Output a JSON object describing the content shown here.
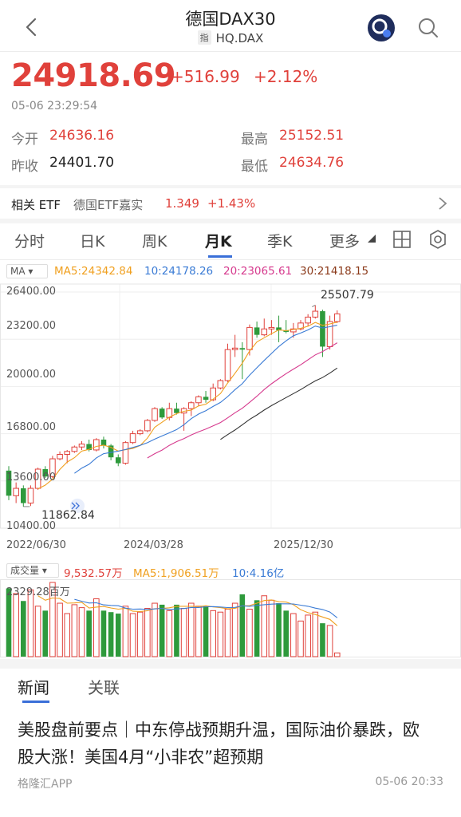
{
  "header": {
    "title": "德国DAX30",
    "tag": "指",
    "code": "HQ.DAX"
  },
  "quote": {
    "price": "24918.69",
    "change": "+516.99",
    "change_pct": "+2.12%",
    "timestamp": "05-06 23:29:54",
    "open_label": "今开",
    "open": "24636.16",
    "high_label": "最高",
    "high": "25152.51",
    "prev_close_label": "昨收",
    "prev_close": "24401.70",
    "low_label": "最低",
    "low": "24634.76"
  },
  "etf": {
    "label": "相关 ETF",
    "name": "德国ETF嘉实",
    "price": "1.349",
    "change_pct": "+1.43%"
  },
  "tabs": [
    "分时",
    "日K",
    "周K",
    "月K",
    "季K",
    "更多"
  ],
  "active_tab": "月K",
  "ma": {
    "selector": "MA",
    "ma5": "MA5:24342.84",
    "ma10": "10:24178.26",
    "ma20": "20:23065.61",
    "ma30": "30:21418.15"
  },
  "price_axis": {
    "labels": [
      "26400.00",
      "23200.00",
      "20000.00",
      "16800.00",
      "13600.00",
      "10400.00"
    ],
    "max_marker": "25507.79",
    "min_marker": "11862.84"
  },
  "date_axis": [
    "2022/06/30",
    "2024/03/28",
    "2025/12/30"
  ],
  "volume": {
    "selector": "成交量",
    "vol": "9,532.57万",
    "ma5": "MA5:1,906.51万",
    "ma10": "10:4.16亿",
    "max_label": "2329.28百万"
  },
  "colors": {
    "up": "#e0413b",
    "down": "#2e9a3c",
    "ma5": "#f0a020",
    "ma10": "#3a7bd5",
    "ma20": "#d63a8e",
    "ma30": "#333333"
  },
  "chart_data": {
    "type": "candlestick",
    "interval": "monthly",
    "ylim": [
      10400,
      26400
    ],
    "candles": [
      [
        14300,
        12600,
        14600,
        12300
      ],
      [
        12600,
        13100,
        13500,
        12100
      ],
      [
        13100,
        12100,
        13300,
        11862.84
      ],
      [
        12100,
        13100,
        13300,
        11900
      ],
      [
        13100,
        14400,
        14500,
        13000
      ],
      [
        14400,
        13900,
        14600,
        13800
      ],
      [
        13900,
        15100,
        15300,
        13800
      ],
      [
        15100,
        15400,
        15600,
        15000
      ],
      [
        15400,
        15600,
        15700,
        14800
      ],
      [
        15600,
        15900,
        16000,
        15500
      ],
      [
        15900,
        16100,
        16300,
        15700
      ],
      [
        16100,
        15700,
        16400,
        15600
      ],
      [
        15700,
        16400,
        16500,
        15600
      ],
      [
        16400,
        16000,
        16600,
        15800
      ],
      [
        16000,
        15200,
        16100,
        15000
      ],
      [
        15200,
        14800,
        15400,
        14600
      ],
      [
        14800,
        16200,
        16300,
        14700
      ],
      [
        16200,
        16800,
        17000,
        16100
      ],
      [
        16800,
        17000,
        17100,
        16700
      ],
      [
        17000,
        17700,
        17800,
        16900
      ],
      [
        17700,
        18500,
        18600,
        17600
      ],
      [
        18500,
        17900,
        18600,
        17800
      ],
      [
        17900,
        18500,
        18900,
        17700
      ],
      [
        18500,
        18200,
        18900,
        18100
      ],
      [
        18200,
        18500,
        18600,
        17000
      ],
      [
        18500,
        18900,
        19000,
        18000
      ],
      [
        18900,
        19300,
        19400,
        18700
      ],
      [
        19300,
        19100,
        19700,
        18900
      ],
      [
        19100,
        19900,
        20200,
        19000
      ],
      [
        19900,
        20400,
        20500,
        19800
      ],
      [
        20400,
        22500,
        22900,
        20300
      ],
      [
        22500,
        22600,
        23500,
        22000
      ],
      [
        22600,
        22500,
        23000,
        20500
      ],
      [
        22500,
        24000,
        24200,
        22100
      ],
      [
        24000,
        23500,
        24400,
        23300
      ],
      [
        23500,
        23900,
        24600,
        23400
      ],
      [
        23900,
        24000,
        24500,
        23500
      ],
      [
        24000,
        23800,
        24800,
        23000
      ],
      [
        23800,
        23700,
        24500,
        23600
      ],
      [
        23700,
        23900,
        24300,
        23300
      ],
      [
        23900,
        24300,
        24500,
        23800
      ],
      [
        24300,
        24700,
        24900,
        24100
      ],
      [
        24700,
        25100,
        25507.79,
        24600
      ],
      [
        25100,
        22700,
        25200,
        22000
      ],
      [
        22700,
        24400,
        24800,
        22500
      ],
      [
        24400,
        24918.69,
        25152.51,
        24300
      ]
    ],
    "volume_ratio": [
      0.92,
      0.85,
      0.75,
      0.9,
      0.68,
      0.62,
      1.0,
      0.72,
      0.58,
      0.7,
      0.66,
      0.62,
      0.78,
      0.62,
      0.6,
      0.58,
      0.68,
      0.58,
      0.6,
      0.65,
      0.72,
      0.7,
      0.62,
      0.7,
      0.65,
      0.72,
      0.68,
      0.68,
      0.62,
      0.6,
      0.64,
      0.72,
      0.84,
      0.64,
      0.76,
      0.82,
      0.76,
      0.72,
      0.62,
      0.58,
      0.48,
      0.56,
      0.6,
      0.45,
      0.42,
      0.05
    ]
  },
  "news": {
    "tabs": [
      "新闻",
      "关联"
    ],
    "title": "美股盘前要点｜中东停战预期升温，国际油价暴跌，欧股大涨！美国4月“小非农”超预期",
    "source": "格隆汇APP",
    "time": "05-06 20:33"
  }
}
